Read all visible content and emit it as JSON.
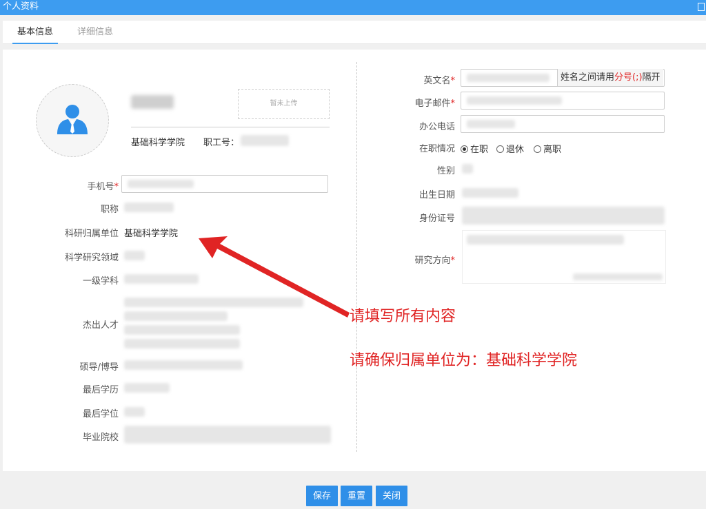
{
  "window": {
    "title": "个人资料"
  },
  "tabs": [
    {
      "label": "基本信息",
      "active": true
    },
    {
      "label": "详细信息",
      "active": false
    }
  ],
  "profile": {
    "upload_placeholder": "暂未上传",
    "college": "基础科学学院",
    "staff_id_label": "职工号："
  },
  "left_fields": {
    "phone_label": "手机号",
    "title_label": "职称",
    "unit_label": "科研归属单位",
    "unit_value": "基础科学学院",
    "research_area_label": "科学研究领域",
    "discipline_label": "一级学科",
    "talent_label": "杰出人才",
    "supervisor_label": "硕导/博导",
    "last_education_label": "最后学历",
    "last_degree_label": "最后学位",
    "school_label": "毕业院校"
  },
  "right_fields": {
    "english_name_label": "英文名",
    "english_name_addon_pre": "姓名之间请用",
    "english_name_addon_hl": "分号(;)",
    "english_name_addon_post": "隔开",
    "email_label": "电子邮件",
    "office_phone_label": "办公电话",
    "employment_label": "在职情况",
    "employment_options": [
      "在职",
      "退休",
      "离职"
    ],
    "employment_selected": "在职",
    "gender_label": "性别",
    "birthdate_label": "出生日期",
    "id_card_label": "身份证号",
    "research_direction_label": "研究方向"
  },
  "annotations": {
    "line1": "请填写所有内容",
    "line2": "请确保归属单位为：基础科学学院",
    "color": "#e02424"
  },
  "buttons": {
    "save": "保存",
    "reset": "重置",
    "close": "关闭"
  },
  "colors": {
    "title_bar": "#3d9cf0",
    "button": "#2f8fe8",
    "required": "#e02424"
  }
}
